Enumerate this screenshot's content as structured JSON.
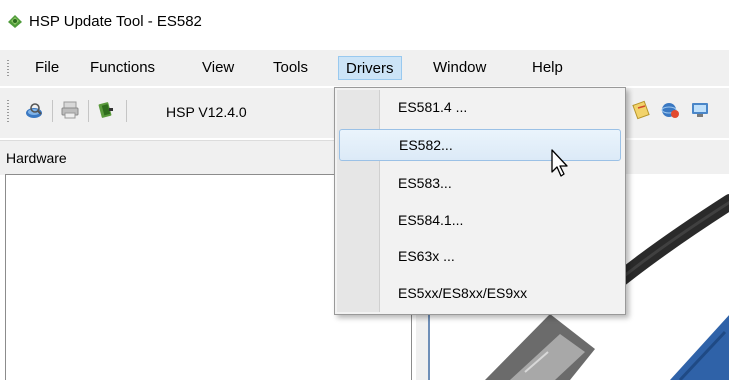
{
  "window": {
    "title": "HSP Update Tool - ES582"
  },
  "menubar": {
    "items": [
      {
        "label": "File"
      },
      {
        "label": "Functions"
      },
      {
        "label": "View"
      },
      {
        "label": "Tools"
      },
      {
        "label": "Drivers",
        "active": true
      },
      {
        "label": "Window"
      },
      {
        "label": "Help"
      }
    ]
  },
  "toolbar": {
    "version_label": "HSP V12.4.0",
    "icons": [
      "search-globe-icon",
      "printer-icon",
      "hardware-icon",
      "notes-icon",
      "globe-help-icon",
      "network-icon"
    ]
  },
  "hardware_panel": {
    "title": "Hardware"
  },
  "drivers_menu": {
    "items": [
      {
        "label": "ES581.4 ..."
      },
      {
        "label": "ES582...",
        "highlighted": true
      },
      {
        "label": "ES583..."
      },
      {
        "label": "ES584.1..."
      },
      {
        "label": "ES63x ..."
      },
      {
        "label": "ES5xx/ES8xx/ES9xx"
      }
    ]
  },
  "colors": {
    "menu_active": "#cce4f7",
    "menu_highlight": "#dceaf7",
    "chrome_bg": "#f0f0f0",
    "device_blue": "#2f62a8"
  }
}
